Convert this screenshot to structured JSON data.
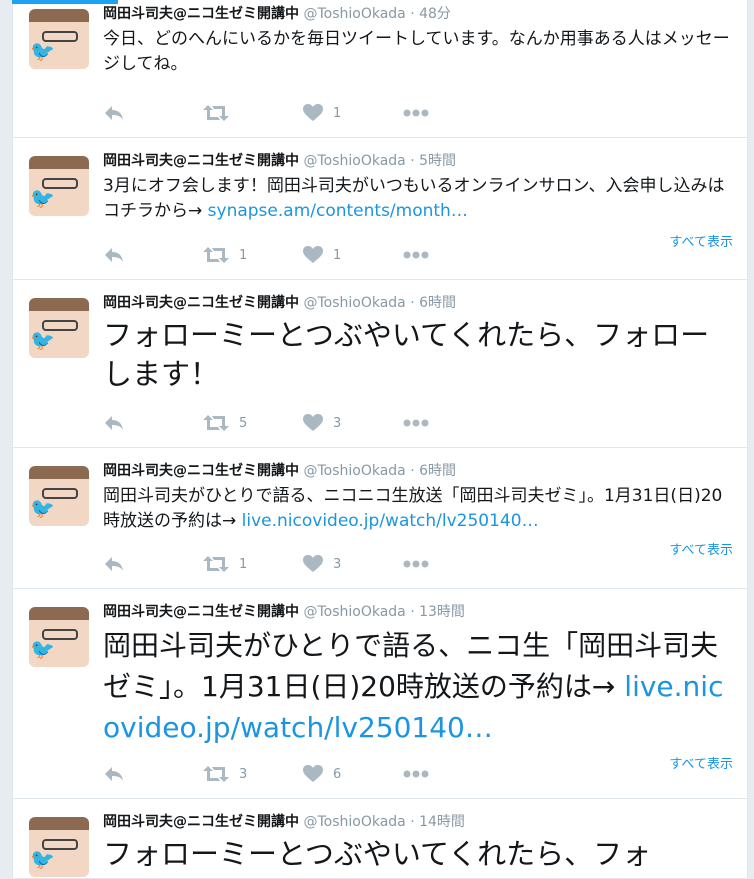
{
  "tweets": [
    {
      "name": "岡田斗司夫@ニコ生ゼミ開講中",
      "handle": "@ToshioOkada",
      "time": "48分",
      "text": "今日、どのへんにいるかを毎日ツイートしています。なんか用事ある人はメッセージしてね。",
      "link": "",
      "retweets": "",
      "likes": "1",
      "show_all": ""
    },
    {
      "name": "岡田斗司夫@ニコ生ゼミ開講中",
      "handle": "@ToshioOkada",
      "time": "5時間",
      "text": "3月にオフ会します！岡田斗司夫がいつもいるオンラインサロン、入会申し込みはコチラから→ ",
      "link": "synapse.am/contents/month…",
      "retweets": "1",
      "likes": "1",
      "show_all": "すべて表示"
    },
    {
      "name": "岡田斗司夫@ニコ生ゼミ開講中",
      "handle": "@ToshioOkada",
      "time": "6時間",
      "text": "フォローミーとつぶやいてくれたら、フォローします！",
      "link": "",
      "retweets": "5",
      "likes": "3",
      "show_all": ""
    },
    {
      "name": "岡田斗司夫@ニコ生ゼミ開講中",
      "handle": "@ToshioOkada",
      "time": "6時間",
      "text": "岡田斗司夫がひとりで語る、ニコニコ生放送「岡田斗司夫ゼミ」。1月31日(日)20時放送の予約は→ ",
      "link": "live.nicovideo.jp/watch/lv250140…",
      "retweets": "1",
      "likes": "3",
      "show_all": "すべて表示"
    },
    {
      "name": "岡田斗司夫@ニコ生ゼミ開講中",
      "handle": "@ToshioOkada",
      "time": "13時間",
      "text": "岡田斗司夫がひとりで語る、ニコ生「岡田斗司夫ゼミ」。1月31日(日)20時放送の予約は→ ",
      "link": "live.nicovideo.jp/watch/lv250140…",
      "retweets": "3",
      "likes": "6",
      "show_all": "すべて表示"
    },
    {
      "name": "岡田斗司夫@ニコ生ゼミ開講中",
      "handle": "@ToshioOkada",
      "time": "14時間",
      "text": "フォローミーとつぶやいてくれたら、フォ",
      "link": "",
      "retweets": "",
      "likes": "",
      "show_all": ""
    }
  ],
  "icons": {
    "reply": "reply-icon",
    "retweet": "retweet-icon",
    "like": "heart-icon",
    "more": "more-dots-icon"
  },
  "colors": {
    "link": "#1b95e0",
    "icon": "#aab8c2",
    "accent": "#1da1f2"
  }
}
